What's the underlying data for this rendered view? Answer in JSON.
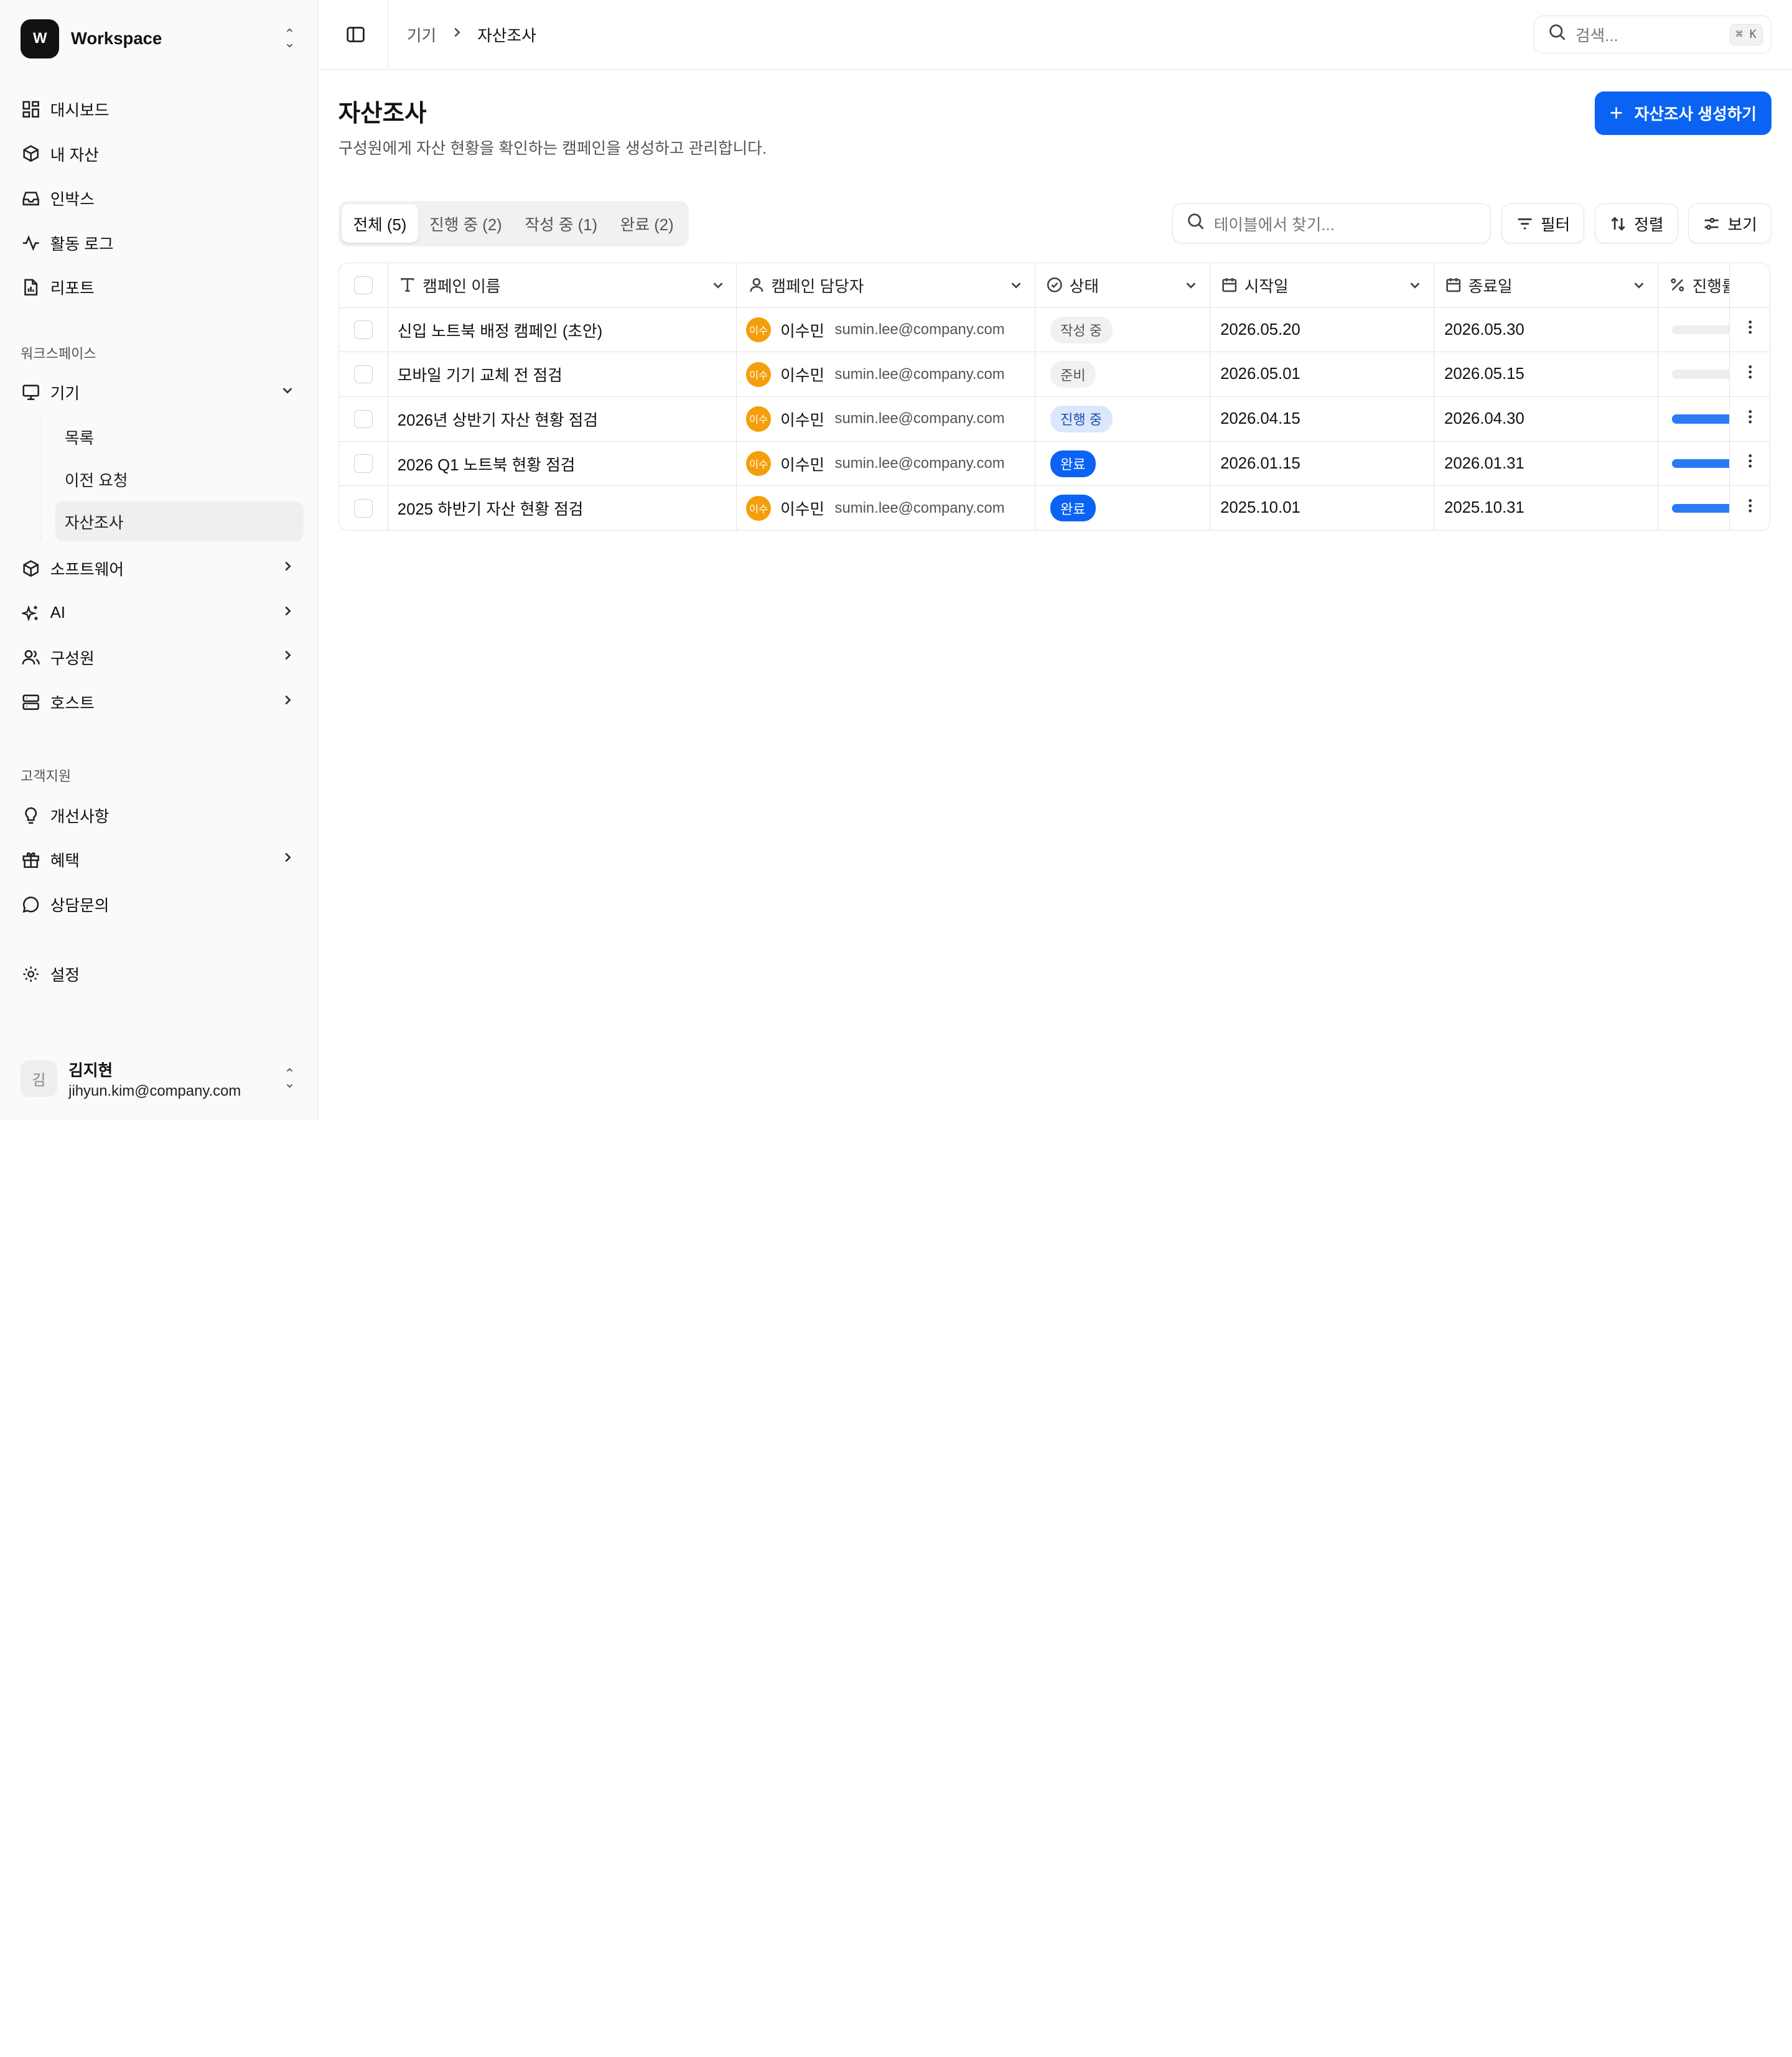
{
  "workspace": {
    "logo": "W",
    "name": "Workspace"
  },
  "nav": {
    "primary": [
      {
        "label": "대시보드",
        "icon": "dashboard-icon"
      },
      {
        "label": "내 자산",
        "icon": "box-icon"
      },
      {
        "label": "인박스",
        "icon": "inbox-icon"
      },
      {
        "label": "활동 로그",
        "icon": "activity-icon"
      },
      {
        "label": "리포트",
        "icon": "report-icon"
      }
    ],
    "workspace_title": "워크스페이스",
    "devices": {
      "label": "기기",
      "sub": [
        "목록",
        "이전 요청",
        "자산조사"
      ]
    },
    "workspace_items": [
      "소프트웨어",
      "AI",
      "구성원",
      "호스트"
    ],
    "support_title": "고객지원",
    "support_items": [
      "개선사항",
      "혜택",
      "상담문의"
    ],
    "settings": "설정"
  },
  "user": {
    "initial": "김",
    "name": "김지현",
    "email": "jihyun.kim@company.com"
  },
  "topbar": {
    "breadcrumb_parent": "기기",
    "breadcrumb_current": "자산조사",
    "search_placeholder": "검색...",
    "shortcut": "⌘ K"
  },
  "page": {
    "title": "자산조사",
    "description": "구성원에게 자산 현황을 확인하는 캠페인을 생성하고 관리합니다.",
    "create_button": "자산조사 생성하기"
  },
  "tabs": [
    "전체 (5)",
    "진행 중 (2)",
    "작성 중 (1)",
    "완료 (2)"
  ],
  "table_tools": {
    "search_placeholder": "테이블에서 찾기...",
    "filter": "필터",
    "sort": "정렬",
    "view": "보기"
  },
  "columns": [
    "캠페인 이름",
    "캠페인 담당자",
    "상태",
    "시작일",
    "종료일",
    "진행률"
  ],
  "rows": [
    {
      "name": "신입 노트북 배정 캠페인 (초안)",
      "owner_initials": "이수",
      "owner": "이수민",
      "email": "sumin.lee@company.com",
      "status": "작성 중",
      "status_type": "draft",
      "start": "2026.05.20",
      "end": "2026.05.30",
      "progress": 0
    },
    {
      "name": "모바일 기기 교체 전 점검",
      "owner_initials": "이수",
      "owner": "이수민",
      "email": "sumin.lee@company.com",
      "status": "준비",
      "status_type": "ready",
      "start": "2026.05.01",
      "end": "2026.05.15",
      "progress": 0
    },
    {
      "name": "2026년 상반기 자산 현황 점검",
      "owner_initials": "이수",
      "owner": "이수민",
      "email": "sumin.lee@company.com",
      "status": "진행 중",
      "status_type": "progress",
      "start": "2026.04.15",
      "end": "2026.04.30",
      "progress": 1
    },
    {
      "name": "2026 Q1 노트북 현황 점검",
      "owner_initials": "이수",
      "owner": "이수민",
      "email": "sumin.lee@company.com",
      "status": "완료",
      "status_type": "done",
      "start": "2026.01.15",
      "end": "2026.01.31",
      "progress": 1
    },
    {
      "name": "2025 하반기 자산 현황 점검",
      "owner_initials": "이수",
      "owner": "이수민",
      "email": "sumin.lee@company.com",
      "status": "완료",
      "status_type": "done",
      "start": "2025.10.01",
      "end": "2025.10.31",
      "progress": 1
    }
  ],
  "colors": {
    "accent": "#0b63f3",
    "avatar": "#f59e0b",
    "progress": "#2b7af5"
  }
}
